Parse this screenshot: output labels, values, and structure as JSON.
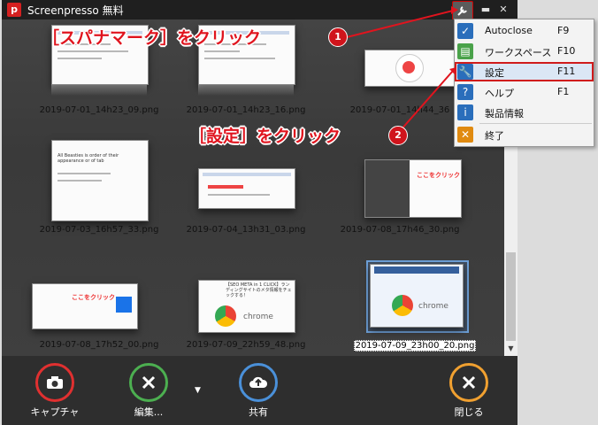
{
  "window": {
    "title": "Screenpresso 無料",
    "logo_letter": "p"
  },
  "gallery": {
    "items": [
      {
        "filename": "2019-07-01_14h23_09.png",
        "selected": false
      },
      {
        "filename": "2019-07-01_14h23_16.png",
        "selected": false
      },
      {
        "filename": "2019-07-01_14h44_36",
        "selected": false
      },
      {
        "filename": "2019-07-03_16h57_33.png",
        "selected": false
      },
      {
        "filename": "2019-07-04_13h31_03.png",
        "selected": false
      },
      {
        "filename": "2019-07-08_17h46_30.png",
        "selected": false
      },
      {
        "filename": "2019-07-08_17h52_00.png",
        "selected": false
      },
      {
        "filename": "2019-07-09_22h59_48.png",
        "selected": false
      },
      {
        "filename": "2019-07-09_23h00_20.png",
        "selected": true
      }
    ],
    "thumb_texts": {
      "t4": "All Beasties is order of their appearance or of tab",
      "t7": "ここをクリック",
      "t8_title": "【SEO META in 1 CLICK】ランディングサイトのメタ情報をチェックする！",
      "t8_chrome": "chrome",
      "t9_chrome": "chrome",
      "t6": "ここをクリック"
    }
  },
  "toolbar": {
    "capture": "キャプチャ",
    "edit": "編集...",
    "share": "共有",
    "close": "閉じる"
  },
  "menu": {
    "items": [
      {
        "label": "Autoclose",
        "key": "F9",
        "icon": "check-icon",
        "color": "#2a6ebb"
      },
      {
        "label": "ワークスペース",
        "key": "F10",
        "icon": "workspace-icon",
        "color": "#4aa24a"
      },
      {
        "label": "設定",
        "key": "F11",
        "icon": "wrench-icon",
        "color": "#2a6ebb"
      },
      {
        "label": "ヘルプ",
        "key": "F1",
        "icon": "help-icon",
        "color": "#2a6ebb"
      },
      {
        "label": "製品情報",
        "key": "",
        "icon": "info-icon",
        "color": "#2a6ebb"
      },
      {
        "label": "終了",
        "key": "",
        "icon": "close-icon",
        "color": "#e08a10"
      }
    ]
  },
  "annotations": {
    "step1": "［スパナマーク］をクリック",
    "step1_num": "1",
    "step2": "［設定］をクリック",
    "step2_num": "2"
  },
  "colors": {
    "annotation_red": "#e0141e",
    "capture_ring": "#e03030",
    "edit_ring": "#4caf50",
    "share_ring": "#4a90d9",
    "close_ring": "#f0a030"
  }
}
